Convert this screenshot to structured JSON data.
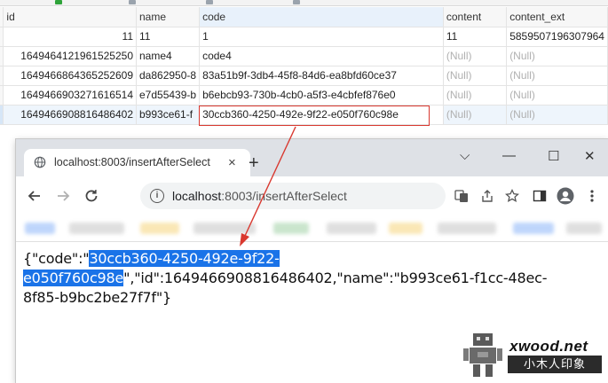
{
  "grid": {
    "columns": [
      "id",
      "name",
      "code",
      "content",
      "content_ext"
    ],
    "rows": [
      {
        "id": "11",
        "name": "11",
        "code": "1",
        "content": "11",
        "content_ext": "5859507196307964"
      },
      {
        "id": "1649464121961525250",
        "name": "name4",
        "code": "code4",
        "content": "(Null)",
        "content_ext": "(Null)"
      },
      {
        "id": "1649466864365252609",
        "name": "da862950-8",
        "code": "83a51b9f-3db4-45f8-84d6-ea8bfd60ce37",
        "content": "(Null)",
        "content_ext": "(Null)"
      },
      {
        "id": "1649466903271616514",
        "name": "e7d55439-b",
        "code": "b6ebcb93-730b-4cb0-a5f3-e4cbfef876e0",
        "content": "(Null)",
        "content_ext": "(Null)"
      },
      {
        "id": "1649466908816486402",
        "name": "b993ce61-f",
        "code": "30ccb360-4250-492e-9f22-e050f760c98e",
        "content": "(Null)",
        "content_ext": "(Null)"
      }
    ]
  },
  "browser": {
    "tab_title": "localhost:8003/insertAfterSelect",
    "tab_close": "×",
    "new_tab": "+",
    "win_minimize": "⌵",
    "win_min": "—",
    "win_max": "☐",
    "win_close": "✕",
    "url_host": "localhost",
    "url_rest": ":8003/insertAfterSelect",
    "response": {
      "before": "{\"code\":\"",
      "highlight": "30ccb360-4250-492e-9f22-e050f760c98e",
      "after": "\",\"id\":1649466908816486402,\"name\":\"b993ce61-f1cc-48ec-8f85-b9bc2be27f7f\"}"
    }
  },
  "watermark": {
    "site": "xwood.net",
    "cn": "小木人印象"
  },
  "colors": {
    "highlight": "#1a73e8",
    "annotation": "#d9382f"
  }
}
